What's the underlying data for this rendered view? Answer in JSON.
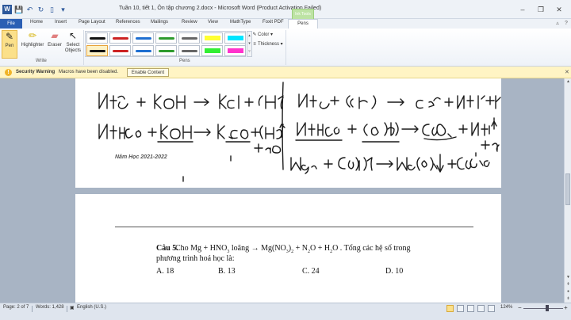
{
  "window": {
    "app_icon": "W",
    "title": "Tuần 10, tiết 1, Ôn tập chương 2.docx  -  Microsoft Word (Product Activation Failed)",
    "context_group": "Ink Tools",
    "controls": {
      "minimize": "–",
      "restore": "❐",
      "close": "✕"
    }
  },
  "qat": [
    "save-icon",
    "undo-icon",
    "redo-icon",
    "print-preview-icon",
    "customize-icon"
  ],
  "tabs": {
    "file": "File",
    "items": [
      "Home",
      "Insert",
      "Page Layout",
      "References",
      "Mailings",
      "Review",
      "View",
      "MathType",
      "Foxit PDF"
    ],
    "active": "Pens"
  },
  "ribbon": {
    "write": {
      "pen": "Pen",
      "highlighter": "Highlighter",
      "eraser": "Eraser",
      "select_line1": "Select",
      "select_line2": "Objects",
      "group_label": "Write"
    },
    "pens": {
      "group_label": "Pens",
      "color_label": "Color",
      "thickness_label": "Thickness",
      "swatches": [
        {
          "color": "#111111",
          "kind": "pen"
        },
        {
          "color": "#cc2222",
          "kind": "pen"
        },
        {
          "color": "#1f6fd1",
          "kind": "pen"
        },
        {
          "color": "#2e9b2e",
          "kind": "pen"
        },
        {
          "color": "#666666",
          "kind": "pen"
        },
        {
          "color": "#ffff33",
          "kind": "highlighter"
        },
        {
          "color": "#00e5ff",
          "kind": "highlighter"
        },
        {
          "color": "#111111",
          "kind": "pen"
        },
        {
          "color": "#cc2222",
          "kind": "pen"
        },
        {
          "color": "#1f6fd1",
          "kind": "pen"
        },
        {
          "color": "#2e9b2e",
          "kind": "pen"
        },
        {
          "color": "#666666",
          "kind": "pen"
        },
        {
          "color": "#33ee33",
          "kind": "highlighter"
        },
        {
          "color": "#ff33cc",
          "kind": "highlighter"
        }
      ],
      "selected_index": 7
    }
  },
  "security": {
    "title": "Security Warning",
    "message": "Macros have been disabled.",
    "button": "Enable Content",
    "close": "✕"
  },
  "document": {
    "page1": {
      "year_footer": "Năm Học 2021-2022"
    },
    "page2": {
      "question_label": "Câu 5.",
      "question_pre": "Cho Mg + HNO",
      "question_sub1": "3",
      "question_mid1": " loãng → Mg(NO",
      "question_sub2": "3",
      "question_mid2": ")",
      "question_sub3": "2",
      "question_mid3": " + N",
      "question_sub4": "2",
      "question_mid4": "O + H",
      "question_sub5": "2",
      "question_end": "O . Tổng các hệ số trong",
      "question_line2": "phương trình hoá học là:",
      "answers": [
        "A. 18",
        "B. 13",
        "C. 24",
        "D. 10"
      ]
    }
  },
  "status": {
    "page": "Page: 2 of 7",
    "words": "Words: 1,428",
    "language": "English (U.S.)",
    "zoom": "124%",
    "zoom_minus": "−",
    "zoom_plus": "+"
  }
}
